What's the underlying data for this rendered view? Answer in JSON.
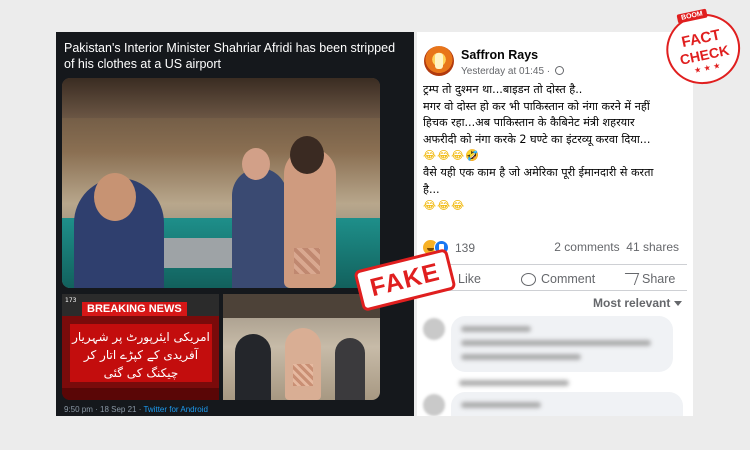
{
  "tweet": {
    "headline": "Pakistan's Interior Minister Shahriar Afridi has been stripped of his clothes at a US airport",
    "breaking_label": "BREAKING NEWS",
    "channel_number": "173",
    "urdu_caption": "امریکی ایئرپورٹ پر شہریار آفریدی کے کپڑے اتار کر چیکنگ کی گئی",
    "timestamp": "9:50 pm · 18 Sep 21 · ",
    "client": "Twitter for Android"
  },
  "stamp": {
    "label": "FAKE"
  },
  "fact_check_logo": {
    "badge": "BOOM",
    "line1": "FACT",
    "line2": "CHECK",
    "stars": "★ ★ ★"
  },
  "post": {
    "author": "Saffron Rays",
    "time": "Yesterday at 01:45 · ",
    "lines": [
      "ट्रम्प तो दुश्मन था...बाइडन तो दोस्त है..",
      "मगर वो दोस्त हो कर भी पाकिस्तान को नंगा करने में नहीं",
      "हिचक रहा...अब पाकिस्तान के कैबिनेट मंत्री शहरयार",
      "अफरीदी को नंगा करके 2 घण्टे का इंटरव्यू करवा दिया...",
      "😂😂😂🤣",
      "वैसे यही एक काम है जो अमेरिका पूरी ईमानदारी से करता",
      "है...",
      "😂😂😂"
    ],
    "reaction_count": "139",
    "comments": "2 comments",
    "shares": "41 shares",
    "actions": {
      "like": "Like",
      "comment": "Comment",
      "share": "Share"
    },
    "sort_label": "Most relevant"
  },
  "colors": {
    "stamp_red": "#e01f1f",
    "fb_blue": "#1877f2",
    "tweet_bg": "#15181c"
  }
}
